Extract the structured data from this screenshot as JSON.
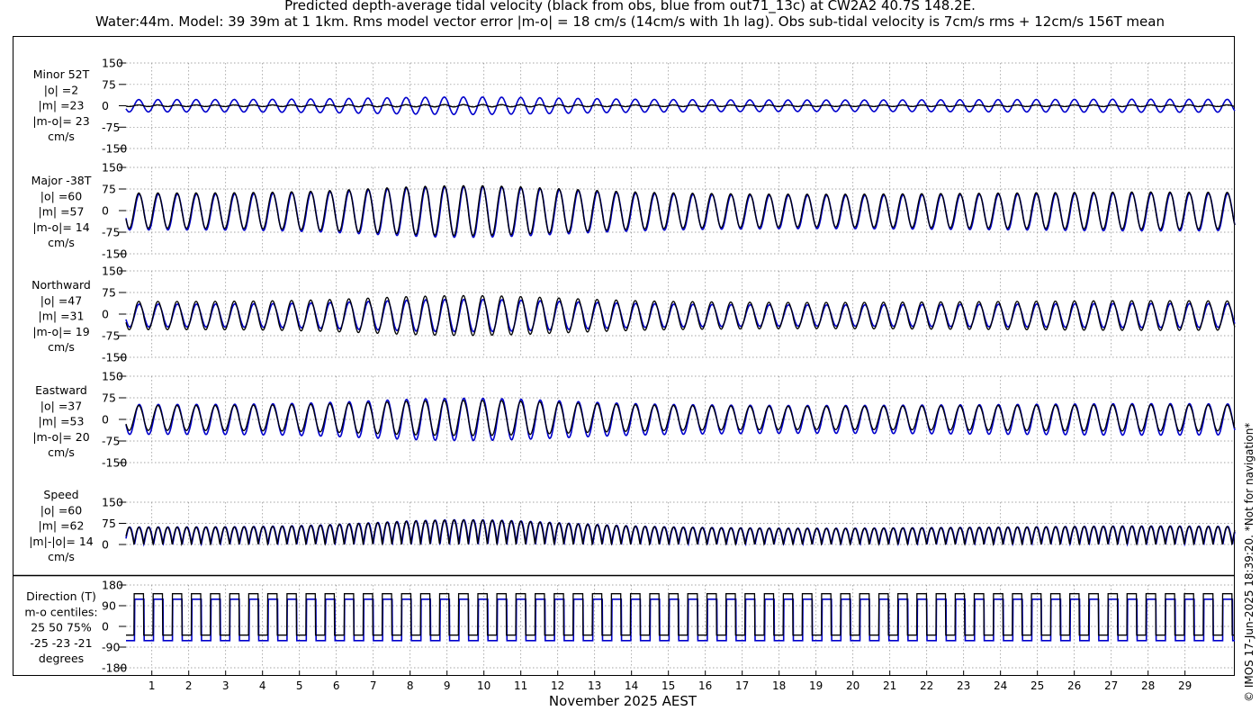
{
  "header": {
    "title_line1": "Predicted depth-average tidal velocity (black from obs, blue from out71_13c) at CW2A2 40.7S 148.2E.",
    "title_line2": "Water:44m. Model: 39 39m at 1 1km. Rms model vector error |m-o| = 18 cm/s (14cm/s with 1h lag). Obs sub-tidal velocity is 7cm/s rms + 12cm/s 156T mean"
  },
  "footer": {
    "xlabel": "November 2025 AEST",
    "side_note": "© IMOS 17-Jun-2025 18:39:20. *Not for navigation*"
  },
  "colors": {
    "obs": "#000000",
    "model": "#0000cc",
    "grid": "#888888"
  },
  "chart_data": [
    {
      "type": "line",
      "panel": "minor",
      "labels": [
        "Minor 52T",
        "|o| =2",
        "|m| =23",
        "|m-o|= 23",
        "cm/s"
      ],
      "ylim": [
        -150,
        150
      ],
      "yticks": [
        150,
        75,
        0,
        -75,
        -150
      ],
      "xlim": [
        0.3,
        30.35
      ],
      "xticks": [
        1,
        2,
        3,
        4,
        5,
        6,
        7,
        8,
        9,
        10,
        11,
        12,
        13,
        14,
        15,
        16,
        17,
        18,
        19,
        20,
        21,
        22,
        23,
        24,
        25,
        26,
        27,
        28,
        29
      ],
      "series": [
        {
          "name": "obs",
          "role": "obs",
          "amplitude_cm_s": 4,
          "phase_lag_h": 0,
          "mean": 0
        },
        {
          "name": "out71_13c",
          "role": "model",
          "amplitude_cm_s": 30,
          "phase_lag_h": 0,
          "mean": 0
        }
      ]
    },
    {
      "type": "line",
      "panel": "major",
      "labels": [
        "Major -38T",
        "|o| =60",
        "|m| =57",
        "|m-o|= 14",
        "cm/s"
      ],
      "ylim": [
        -150,
        150
      ],
      "yticks": [
        150,
        75,
        0,
        -75,
        -150
      ],
      "xlim": [
        0.3,
        30.35
      ],
      "xticks": [
        1,
        2,
        3,
        4,
        5,
        6,
        7,
        8,
        9,
        10,
        11,
        12,
        13,
        14,
        15,
        16,
        17,
        18,
        19,
        20,
        21,
        22,
        23,
        24,
        25,
        26,
        27,
        28,
        29
      ],
      "series": [
        {
          "name": "obs",
          "role": "obs",
          "amplitude_cm_s": 85,
          "phase_lag_h": 0,
          "mean": 0
        },
        {
          "name": "out71_13c",
          "role": "model",
          "amplitude_cm_s": 86,
          "phase_lag_h": 0.3,
          "mean": -5
        }
      ]
    },
    {
      "type": "line",
      "panel": "northward",
      "labels": [
        "Northward",
        "|o| =47",
        "|m| =31",
        "|m-o|= 19",
        "cm/s"
      ],
      "ylim": [
        -150,
        150
      ],
      "yticks": [
        150,
        75,
        0,
        -75,
        -150
      ],
      "xlim": [
        0.3,
        30.35
      ],
      "xticks": [
        1,
        2,
        3,
        4,
        5,
        6,
        7,
        8,
        9,
        10,
        11,
        12,
        13,
        14,
        15,
        16,
        17,
        18,
        19,
        20,
        21,
        22,
        23,
        24,
        25,
        26,
        27,
        28,
        29
      ],
      "series": [
        {
          "name": "obs",
          "role": "obs",
          "amplitude_cm_s": 68,
          "phase_lag_h": 0,
          "mean": -5
        },
        {
          "name": "out71_13c",
          "role": "model",
          "amplitude_cm_s": 55,
          "phase_lag_h": 0.3,
          "mean": -5
        }
      ]
    },
    {
      "type": "line",
      "panel": "eastward",
      "labels": [
        "Eastward",
        "|o| =37",
        "|m| =53",
        "|m-o|= 20",
        "cm/s"
      ],
      "ylim": [
        -150,
        150
      ],
      "yticks": [
        150,
        75,
        0,
        -75,
        -150
      ],
      "xlim": [
        0.3,
        30.35
      ],
      "xticks": [
        1,
        2,
        3,
        4,
        5,
        6,
        7,
        8,
        9,
        10,
        11,
        12,
        13,
        14,
        15,
        16,
        17,
        18,
        19,
        20,
        21,
        22,
        23,
        24,
        25,
        26,
        27,
        28,
        29
      ],
      "series": [
        {
          "name": "obs",
          "role": "obs",
          "amplitude_cm_s": 60,
          "phase_lag_h": 0,
          "mean": 5
        },
        {
          "name": "out71_13c",
          "role": "model",
          "amplitude_cm_s": 72,
          "phase_lag_h": 0.3,
          "mean": 0
        }
      ]
    },
    {
      "type": "line",
      "panel": "speed",
      "labels": [
        "Speed",
        "|o| =60",
        "|m| =62",
        "|m|-|o|= 14",
        "cm/s"
      ],
      "ylim": [
        0,
        150
      ],
      "yticks": [
        150,
        75,
        0
      ],
      "xlim": [
        0.3,
        30.35
      ],
      "xticks": [
        1,
        2,
        3,
        4,
        5,
        6,
        7,
        8,
        9,
        10,
        11,
        12,
        13,
        14,
        15,
        16,
        17,
        18,
        19,
        20,
        21,
        22,
        23,
        24,
        25,
        26,
        27,
        28,
        29
      ],
      "series": [
        {
          "name": "obs",
          "role": "obs",
          "amplitude_cm_s": 85,
          "phase_lag_h": 0,
          "mean": 0
        },
        {
          "name": "out71_13c",
          "role": "model",
          "amplitude_cm_s": 86,
          "phase_lag_h": 0.3,
          "mean": 0
        }
      ]
    },
    {
      "type": "line",
      "panel": "direction",
      "labels": [
        "Direction (T)",
        "m-o centiles:",
        "25  50  75%",
        "-25 -23 -21",
        "degrees"
      ],
      "ylim": [
        -180,
        180
      ],
      "yticks": [
        180,
        90,
        0,
        -90,
        -180
      ],
      "xlim": [
        0.3,
        30.35
      ],
      "xticks": [
        1,
        2,
        3,
        4,
        5,
        6,
        7,
        8,
        9,
        10,
        11,
        12,
        13,
        14,
        15,
        16,
        17,
        18,
        19,
        20,
        21,
        22,
        23,
        24,
        25,
        26,
        27,
        28,
        29
      ],
      "series": [
        {
          "name": "obs",
          "role": "obs",
          "flood_deg": 142,
          "ebb_deg": -38,
          "phase_lag_h": 0
        },
        {
          "name": "out71_13c",
          "role": "model",
          "flood_deg": 118,
          "ebb_deg": -62,
          "phase_lag_h": 0.3
        }
      ]
    }
  ]
}
